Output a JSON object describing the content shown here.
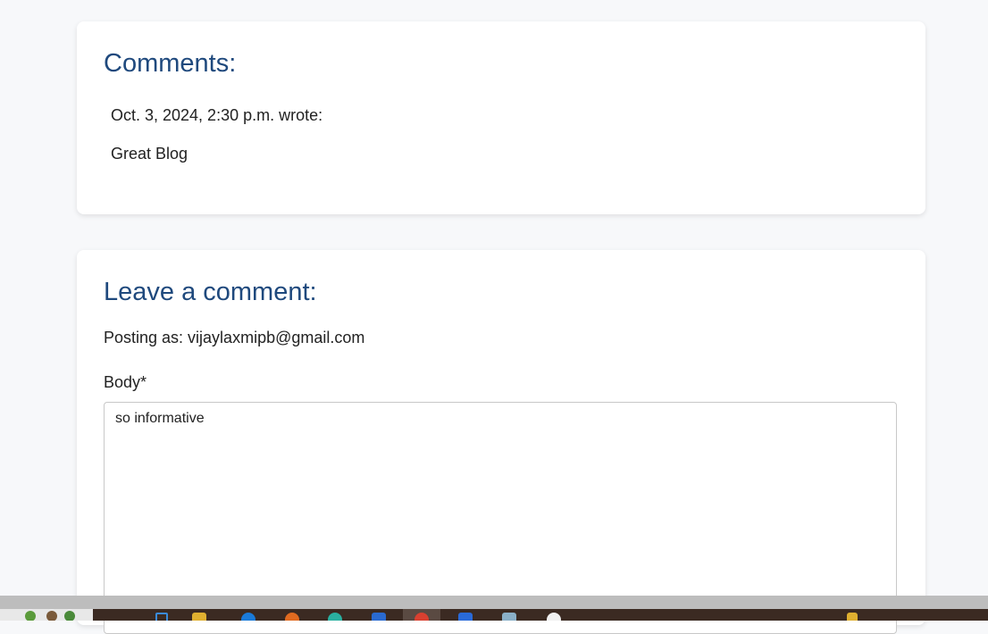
{
  "comments": {
    "heading": "Comments:",
    "items": [
      {
        "meta": "Oct. 3, 2024, 2:30 p.m. wrote:",
        "body": "Great Blog"
      }
    ]
  },
  "leave_comment": {
    "heading": "Leave a comment:",
    "posting_as": "Posting as: vijaylaxmipb@gmail.com",
    "body_label": "Body*",
    "body_value": "so informative"
  },
  "colors": {
    "heading": "#1f497d",
    "page_bg": "#f7f8fa",
    "taskbar": "#3b2a22"
  },
  "taskbar": {
    "icons": [
      "tree-icon",
      "file-explorer-icon",
      "folder-icon",
      "edge-icon",
      "firefox-icon",
      "chrome-alt-icon",
      "mail-icon",
      "chrome-icon",
      "word-icon",
      "notepad-icon",
      "white-circle-icon",
      "notification-icon"
    ]
  }
}
